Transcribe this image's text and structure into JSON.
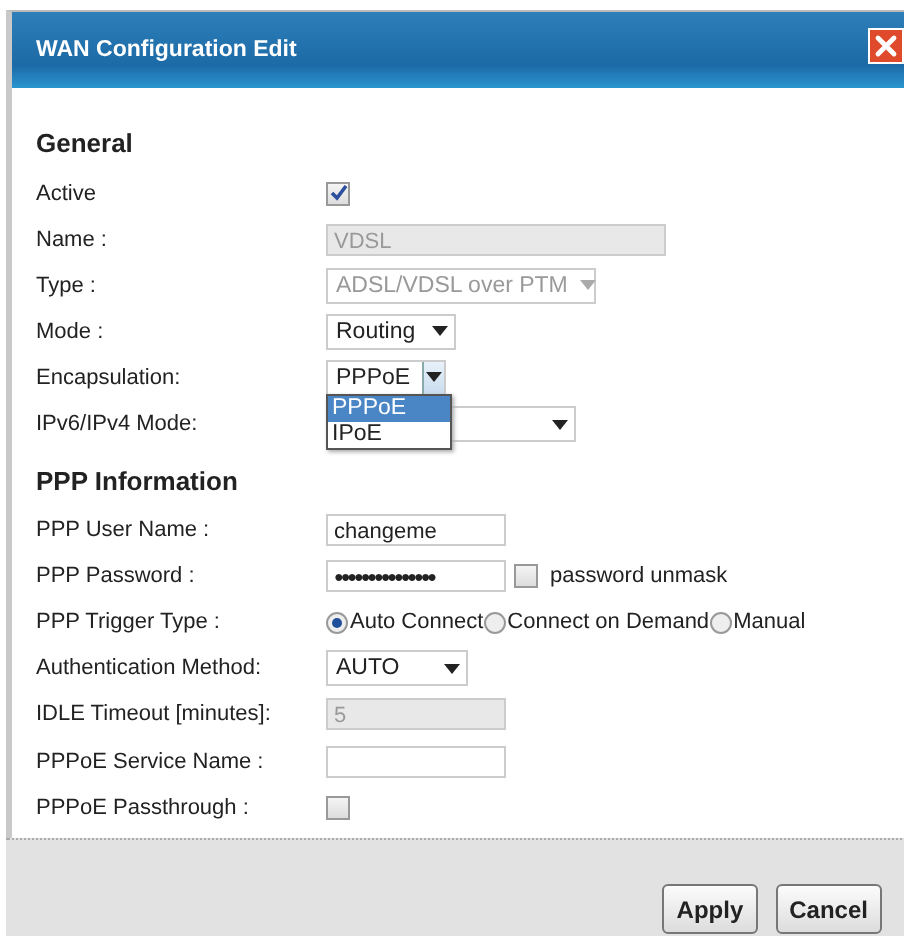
{
  "window": {
    "title": "WAN Configuration Edit"
  },
  "sections": [
    {
      "title": "General",
      "fields": [
        {
          "label": "Active",
          "kind": "checkbox",
          "checked": true
        },
        {
          "label": "Name :",
          "kind": "text",
          "value": "VDSL",
          "disabled": true
        },
        {
          "label": "Type :",
          "kind": "select",
          "value": "ADSL/VDSL over PTM",
          "disabled": true
        },
        {
          "label": "Mode :",
          "kind": "select",
          "value": "Routing",
          "disabled": false
        },
        {
          "label": "Encapsulation:",
          "kind": "select",
          "value": "PPPoE",
          "disabled": false,
          "expanded": true,
          "options": [
            {
              "label": "PPPoE",
              "selected": true
            },
            {
              "label": "IPoE",
              "selected": false
            }
          ]
        },
        {
          "label": "IPv6/IPv4 Mode:",
          "kind": "select",
          "disabled": false
        }
      ]
    },
    {
      "title": "PPP Information",
      "fields": [
        {
          "label": "PPP User Name :",
          "kind": "text",
          "value": "changeme",
          "disabled": false
        },
        {
          "label": "PPP Password :",
          "kind": "password",
          "value": "●●●●●●●●●●●●●●●",
          "unmask": {
            "label": "password unmask",
            "checked": false
          }
        },
        {
          "label": "PPP Trigger Type :",
          "kind": "radio",
          "options": [
            {
              "label": "Auto Connect",
              "selected": true
            },
            {
              "label": "Connect on Demand",
              "selected": false
            },
            {
              "label": "Manual",
              "selected": false
            }
          ]
        },
        {
          "label": "Authentication Method:",
          "kind": "select",
          "value": "AUTO",
          "disabled": false
        },
        {
          "label": "IDLE Timeout [minutes]:",
          "kind": "text",
          "value": "5",
          "disabled": true
        },
        {
          "label": "PPPoE Service Name :",
          "kind": "text",
          "disabled": false
        },
        {
          "label": "PPPoE Passthrough :",
          "kind": "checkbox",
          "checked": false
        }
      ]
    }
  ],
  "buttons": [
    "Apply",
    "Cancel"
  ]
}
